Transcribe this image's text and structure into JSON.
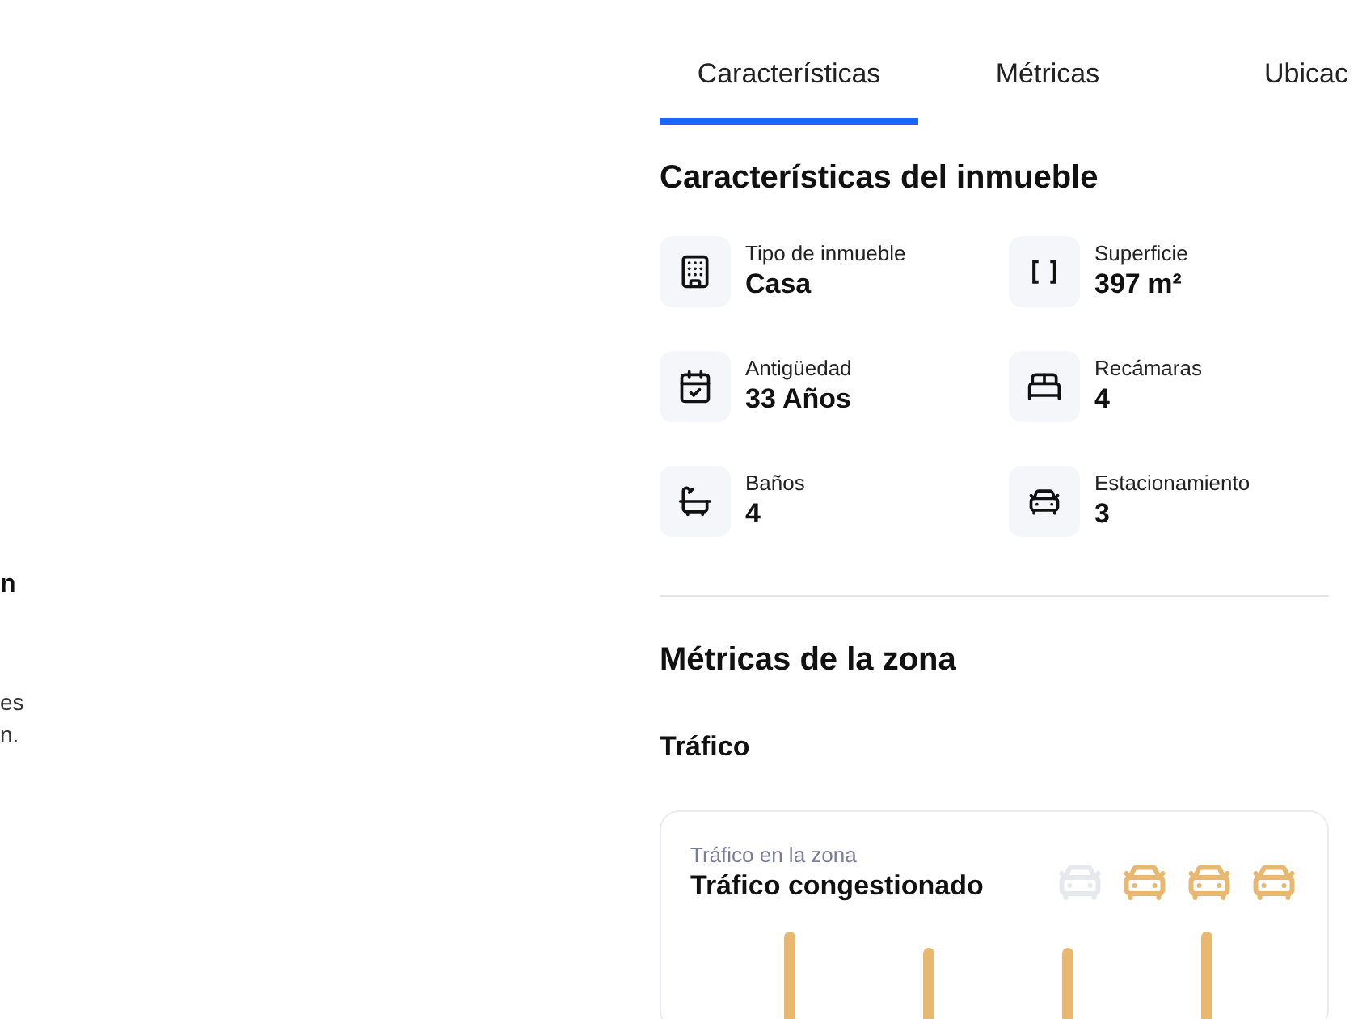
{
  "left_panel": {
    "fragments": [
      {
        "text": "n",
        "kind": "heading"
      },
      {
        "text": "es",
        "kind": "body"
      },
      {
        "text": "n.",
        "kind": "body"
      }
    ]
  },
  "tabs": [
    {
      "label": "Características",
      "selected": true
    },
    {
      "label": "Métricas",
      "selected": false
    },
    {
      "label": "Ubicac",
      "selected": false
    }
  ],
  "features": {
    "title": "Características del inmueble",
    "items": [
      {
        "label": "Tipo de inmueble",
        "value": "Casa"
      },
      {
        "label": "Superficie",
        "value": "397 m²"
      },
      {
        "label": "Antigüedad",
        "value": "33 Años"
      },
      {
        "label": "Recámaras",
        "value": "4"
      },
      {
        "label": "Baños",
        "value": "4"
      },
      {
        "label": "Estacionamiento",
        "value": "3"
      }
    ]
  },
  "metrics": {
    "title": "Métricas de la zona",
    "subtitle": "Tráfico",
    "card": {
      "label": "Tráfico en la zona",
      "title": "Tráfico congestionado",
      "cars": [
        {
          "active": false
        },
        {
          "active": true
        },
        {
          "active": true
        },
        {
          "active": true
        }
      ]
    }
  }
}
